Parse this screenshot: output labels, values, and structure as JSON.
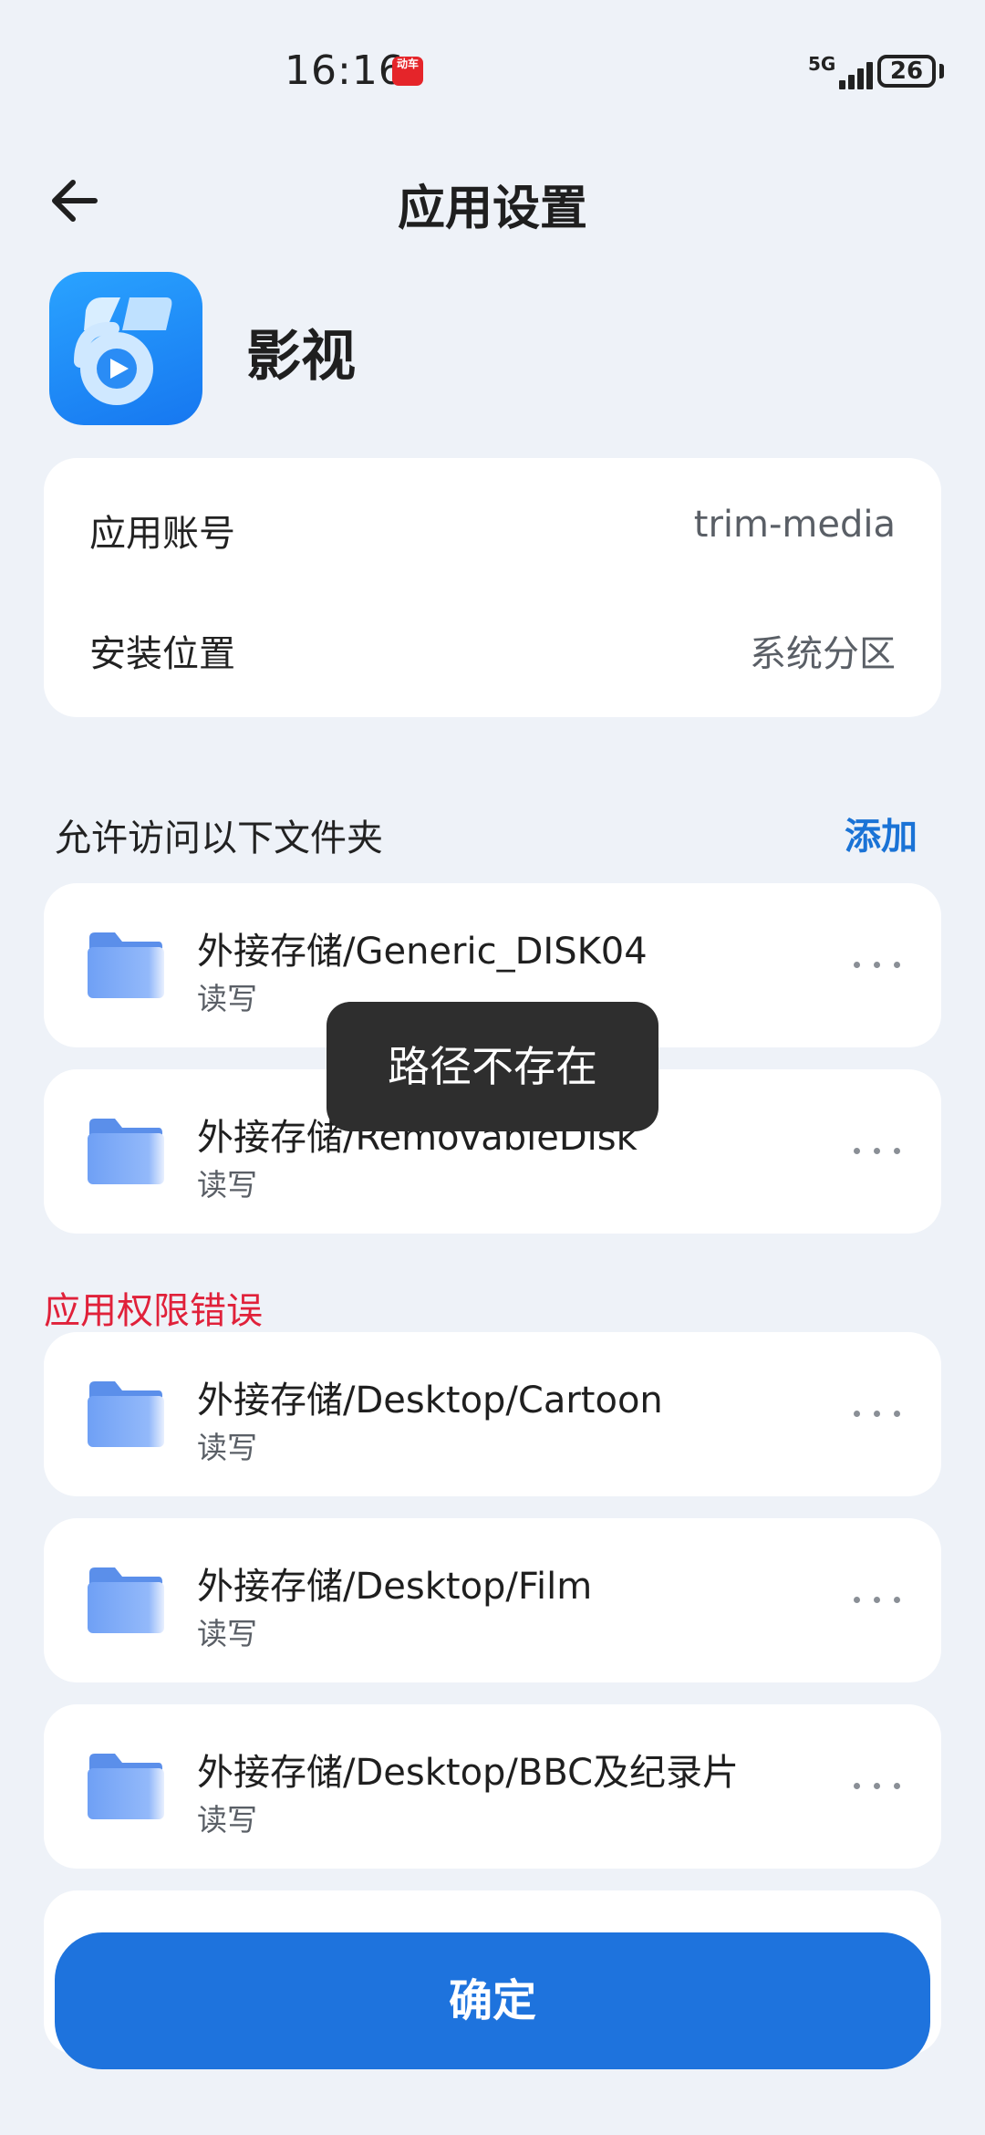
{
  "status_bar": {
    "time": "16:16",
    "badge_text": "动车",
    "network": "5G",
    "battery": "26"
  },
  "header": {
    "title": "应用设置",
    "back_icon": "arrow-left-icon"
  },
  "app": {
    "name": "影视",
    "icon": "film-play-app-icon"
  },
  "info": {
    "rows": [
      {
        "label": "应用账号",
        "value": "trim-media"
      },
      {
        "label": "安装位置",
        "value": "系统分区"
      }
    ]
  },
  "allowed_section": {
    "title": "允许访问以下文件夹",
    "add_label": "添加",
    "folders": [
      {
        "path": "外接存储/Generic_DISK04",
        "permission": "读写"
      },
      {
        "path": "外接存储/RemovableDisk",
        "permission": "读写"
      }
    ]
  },
  "error_section": {
    "title": "应用权限错误",
    "folders": [
      {
        "path": "外接存储/Desktop/Cartoon",
        "permission": "读写"
      },
      {
        "path": "外接存储/Desktop/Film",
        "permission": "读写"
      },
      {
        "path": "外接存储/Desktop/BBC及纪录片",
        "permission": "读写"
      }
    ]
  },
  "toast": "路径不存在",
  "confirm_label": "确定",
  "colors": {
    "background": "#EEF2F8",
    "accent": "#1E73DD",
    "error": "#E0213A",
    "folder": "#6FA0F5"
  }
}
